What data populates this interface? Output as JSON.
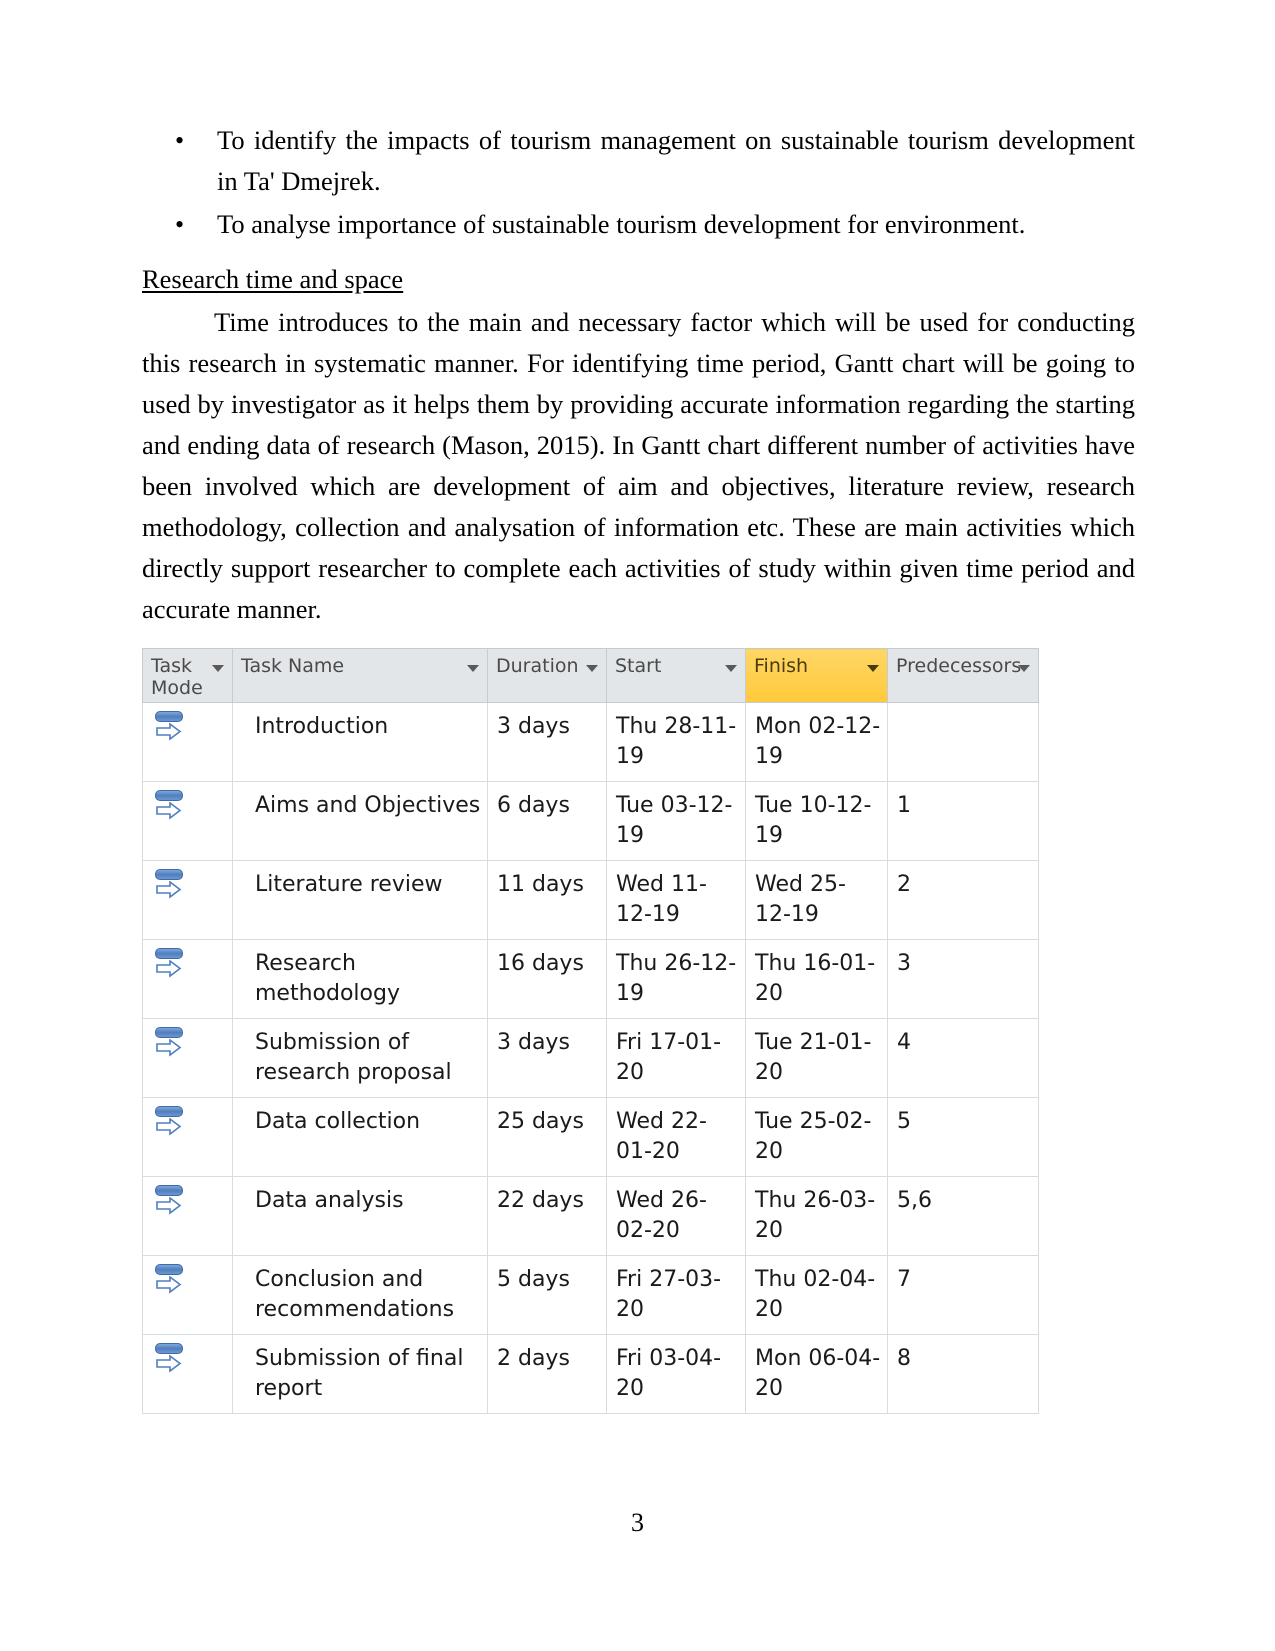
{
  "document": {
    "objectives": [
      {
        "bullet": "•",
        "text": "To identify the impacts of tourism management on sustainable tourism development in Ta' Dmejrek."
      },
      {
        "bullet": "•",
        "text": "To analyse importance of sustainable tourism development for environment."
      }
    ],
    "section_heading": "Research time and space",
    "paragraph": "Time introduces to the main and necessary factor which will be used for conducting this research in systematic manner. For identifying time period, Gantt chart will be going to used by investigator as it helps them by providing accurate information regarding the starting and ending data of research (Mason, 2015). In Gantt chart different number of activities have been involved which are development of aim and objectives, literature review, research methodology, collection and analysation of information etc. These are main activities which directly support researcher to complete each activities of study within given time period and accurate manner.",
    "page_number": "3"
  },
  "gantt_table": {
    "columns": [
      {
        "id": "task_mode",
        "label": "Task Mode",
        "has_filter": true,
        "highlighted": false
      },
      {
        "id": "task_name",
        "label": "Task Name",
        "has_filter": true,
        "highlighted": false
      },
      {
        "id": "duration",
        "label": "Duration",
        "has_filter": true,
        "highlighted": false
      },
      {
        "id": "start",
        "label": "Start",
        "has_filter": true,
        "highlighted": false
      },
      {
        "id": "finish",
        "label": "Finish",
        "has_filter": true,
        "highlighted": true
      },
      {
        "id": "predecessors",
        "label": "Predecessors",
        "has_filter": true,
        "highlighted": false
      }
    ],
    "highlight_color": "#ffd24d",
    "header_background": "#e2e6e9",
    "rows": [
      {
        "mode_icon": "auto-schedule-icon",
        "task_name": "Introduction",
        "duration": "3 days",
        "start": "Thu 28-11-19",
        "finish": "Mon 02-12-19",
        "predecessors": ""
      },
      {
        "mode_icon": "auto-schedule-icon",
        "task_name": "Aims and Objectives",
        "duration": "6 days",
        "start": "Tue 03-12-19",
        "finish": "Tue 10-12-19",
        "predecessors": "1"
      },
      {
        "mode_icon": "auto-schedule-icon",
        "task_name": "Literature review",
        "duration": "11 days",
        "start": "Wed 11-12-19",
        "finish": "Wed 25-12-19",
        "predecessors": "2"
      },
      {
        "mode_icon": "auto-schedule-icon",
        "task_name": "Research methodology",
        "duration": "16 days",
        "start": "Thu 26-12-19",
        "finish": "Thu 16-01-20",
        "predecessors": "3"
      },
      {
        "mode_icon": "auto-schedule-icon",
        "task_name": "Submission of research proposal",
        "duration": "3 days",
        "start": "Fri 17-01-20",
        "finish": "Tue 21-01-20",
        "predecessors": "4"
      },
      {
        "mode_icon": "auto-schedule-icon",
        "task_name": "Data collection",
        "duration": "25 days",
        "start": "Wed 22-01-20",
        "finish": "Tue 25-02-20",
        "predecessors": "5"
      },
      {
        "mode_icon": "auto-schedule-icon",
        "task_name": "Data analysis",
        "duration": "22 days",
        "start": "Wed 26-02-20",
        "finish": "Thu 26-03-20",
        "predecessors": "5,6"
      },
      {
        "mode_icon": "auto-schedule-icon",
        "task_name": "Conclusion and recommendations",
        "duration": "5 days",
        "start": "Fri 27-03-20",
        "finish": "Thu 02-04-20",
        "predecessors": "7"
      },
      {
        "mode_icon": "auto-schedule-icon",
        "task_name": "Submission of final report",
        "duration": "2 days",
        "start": "Fri 03-04-20",
        "finish": "Mon 06-04-20",
        "predecessors": "8"
      }
    ]
  }
}
